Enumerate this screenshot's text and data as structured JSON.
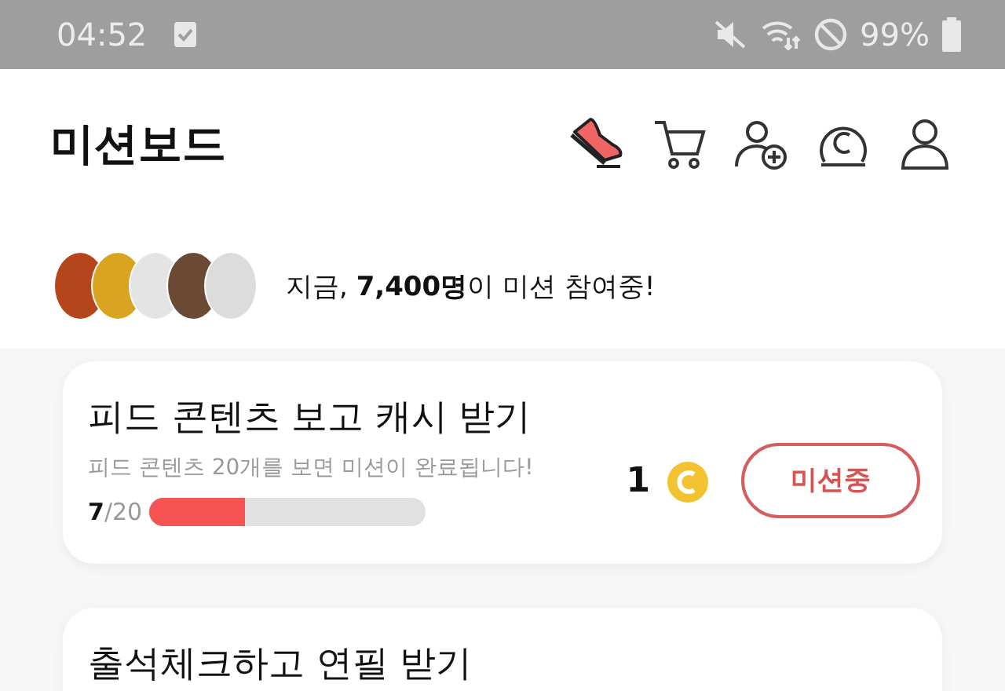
{
  "status_bar": {
    "time": "04:52",
    "battery": "99%"
  },
  "header": {
    "title": "미션보드"
  },
  "participants": {
    "text": "지금, **7,400명**이 미션 참여중!"
  },
  "missions": [
    {
      "title": "피드 콘텐츠 보고 캐시 받기",
      "description": "피드 콘텐츠 20개를 보면 미션이 완료됩니다!",
      "progress_current": "7",
      "progress_total": "/20",
      "level": 0.35,
      "reward": "1",
      "button": "미션중"
    },
    {
      "title": "출석체크하고 연필 받기"
    }
  ]
}
